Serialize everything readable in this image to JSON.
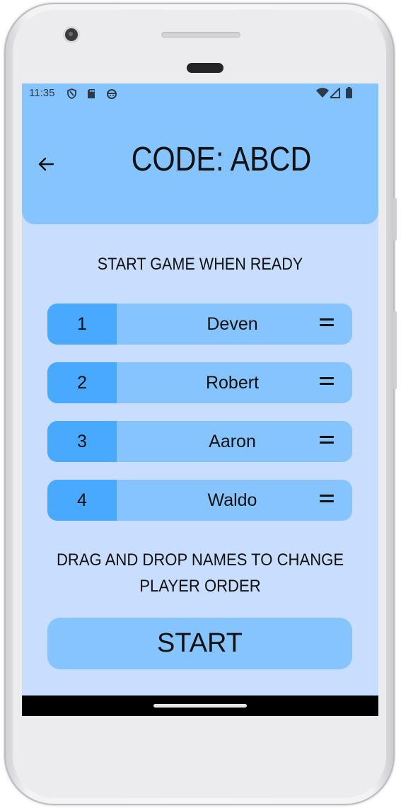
{
  "status_bar": {
    "time": "11:35",
    "left_icons": [
      "shield-icon",
      "sd-card-icon",
      "android-robot-icon"
    ],
    "right_icons": [
      "wifi-icon",
      "cellular-signal-icon",
      "battery-icon"
    ]
  },
  "header": {
    "back_icon": "arrow-left-icon",
    "title": "CODE: ABCD"
  },
  "subtitle": "START GAME WHEN READY",
  "players": [
    {
      "order": "1",
      "name": "Deven"
    },
    {
      "order": "2",
      "name": "Robert"
    },
    {
      "order": "3",
      "name": "Aaron"
    },
    {
      "order": "4",
      "name": "Waldo"
    }
  ],
  "hint_line1": "DRAG AND DROP NAMES TO CHANGE",
  "hint_line2": "PLAYER ORDER",
  "start_label": "START",
  "colors": {
    "background": "#c9defe",
    "header": "#86c4ff",
    "player_row": "#86c4ff",
    "player_number": "#49a9ff",
    "start_button": "#86c4ff"
  }
}
